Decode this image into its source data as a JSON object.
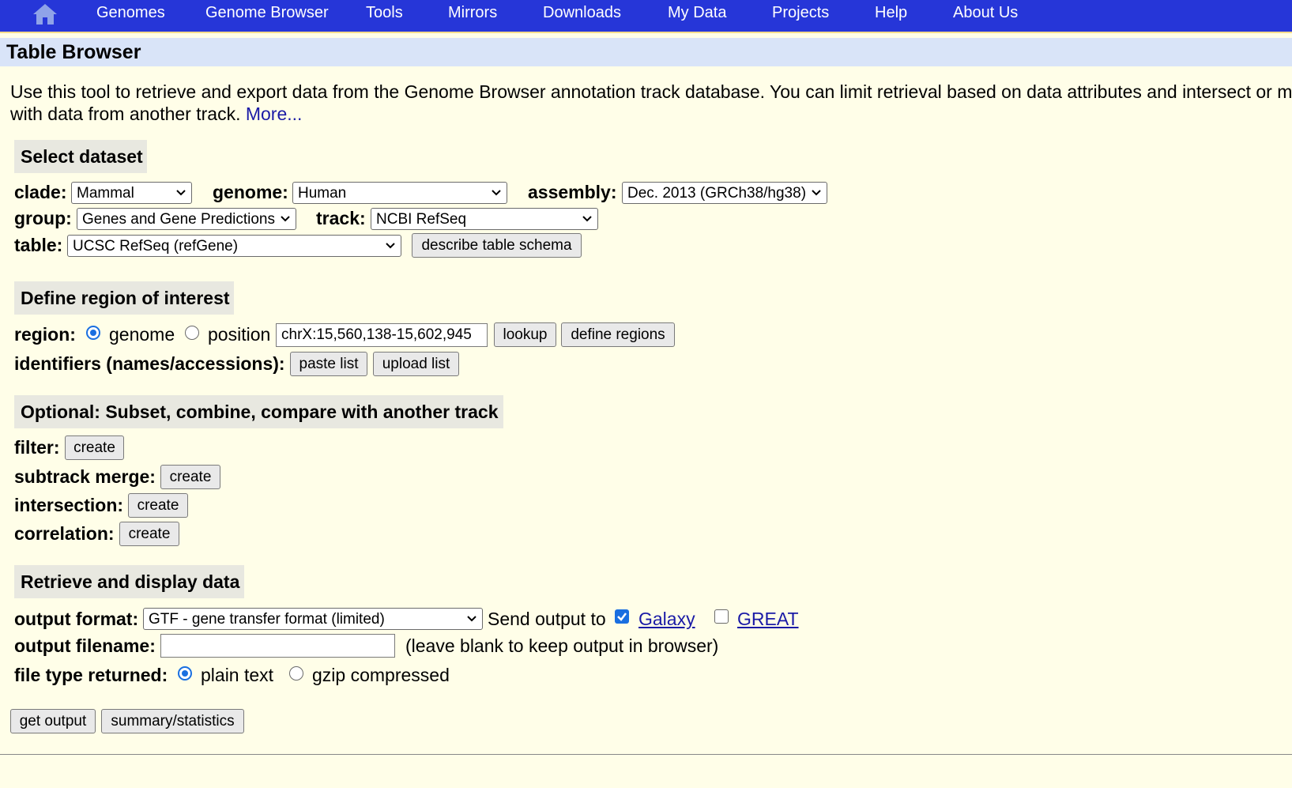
{
  "nav": {
    "items": [
      "Genomes",
      "Genome Browser",
      "Tools",
      "Mirrors",
      "Downloads",
      "My Data",
      "Projects",
      "Help",
      "About Us"
    ],
    "home_icon": "home-icon"
  },
  "page_title": "Table Browser",
  "intro": {
    "text": "Use this tool to retrieve and export data from the Genome Browser annotation track database. You can limit retrieval based on data attributes and intersect or merge with data from another track.",
    "more_link": "More..."
  },
  "select_dataset": {
    "heading": "Select dataset",
    "clade_label": "clade:",
    "clade_value": "Mammal",
    "genome_label": "genome:",
    "genome_value": "Human",
    "assembly_label": "assembly:",
    "assembly_value": "Dec. 2013 (GRCh38/hg38)",
    "group_label": "group:",
    "group_value": "Genes and Gene Predictions",
    "track_label": "track:",
    "track_value": "NCBI RefSeq",
    "table_label": "table:",
    "table_value": "UCSC RefSeq (refGene)",
    "describe_button": "describe table schema"
  },
  "region": {
    "heading": "Define region of interest",
    "region_label": "region:",
    "genome_option": "genome",
    "position_option": "position",
    "selected": "genome",
    "position_value": "chrX:15,560,138-15,602,945",
    "lookup_button": "lookup",
    "define_regions_button": "define regions",
    "identifiers_label": "identifiers (names/accessions):",
    "paste_list_button": "paste list",
    "upload_list_button": "upload list"
  },
  "optional": {
    "heading": "Optional: Subset, combine, compare with another track",
    "filter_label": "filter:",
    "subtrack_label": "subtrack merge:",
    "intersection_label": "intersection:",
    "correlation_label": "correlation:",
    "create_button": "create"
  },
  "retrieve": {
    "heading": "Retrieve and display data",
    "output_format_label": "output format:",
    "output_format_value": "GTF - gene transfer format (limited)",
    "send_output_label": "Send output to",
    "galaxy_label": "Galaxy",
    "galaxy_checked": true,
    "great_label": "GREAT",
    "great_checked": false,
    "filename_label": "output filename:",
    "filename_value": "",
    "filename_hint": "(leave blank to keep output in browser)",
    "file_type_label": "file type returned:",
    "plain_text_option": "plain text",
    "gzip_option": "gzip compressed",
    "file_type_selected": "plain text",
    "get_output_button": "get output",
    "summary_button": "summary/statistics"
  },
  "colors": {
    "navbar": "#2636d8",
    "page_bg": "#fffee8",
    "title_bar": "#d9e4f8",
    "section_bg": "#e8e8e0",
    "link": "#1a1aa6",
    "accent": "#1a6fe0"
  }
}
